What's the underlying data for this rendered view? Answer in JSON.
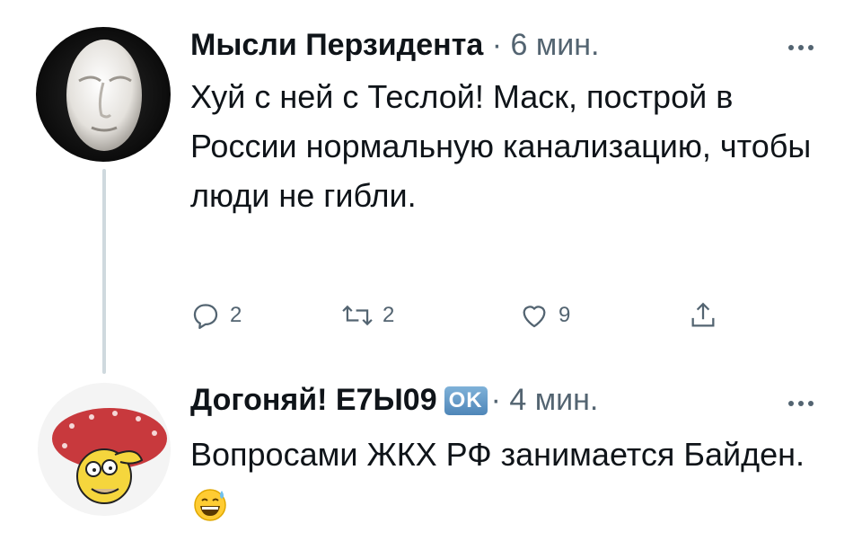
{
  "tweets": [
    {
      "author": "Мысли Перзидента",
      "separator": "·",
      "time": "6 мин.",
      "text": "Хуй с ней с Теслой! Маск, построй в России нормальную канализацию, чтобы люди не гибли.",
      "actions": {
        "reply_count": "2",
        "retweet_count": "2",
        "like_count": "9"
      }
    },
    {
      "author": "Догоняй! Е7Ы09",
      "badge": "OK",
      "separator": "·",
      "time": "4 мин.",
      "text": "Вопросами ЖКХ РФ занимается Байден.",
      "emoji": "grinning-sweat-emoji"
    }
  ],
  "icons": {
    "more": "more-dots-icon",
    "reply": "reply-icon",
    "retweet": "retweet-icon",
    "like": "like-icon",
    "share": "share-icon"
  },
  "colors": {
    "text": "#0f1419",
    "secondary": "#536471",
    "thread_line": "#cfd9de",
    "badge": "#5b92c2"
  }
}
